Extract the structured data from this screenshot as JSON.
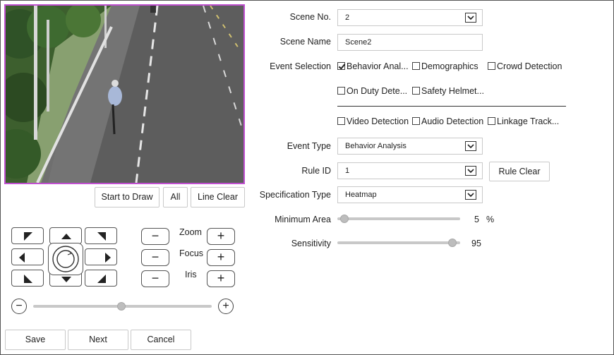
{
  "video": {
    "scene": "street-camera-view"
  },
  "draw": {
    "start_label": "Start to Draw",
    "all_label": "All",
    "clear_label": "Line Clear"
  },
  "ptz": {
    "zoom_label": "Zoom",
    "focus_label": "Focus",
    "iris_label": "Iris",
    "minus": "−",
    "plus": "+",
    "speed_level": 0.5
  },
  "form": {
    "scene_no": {
      "label": "Scene No.",
      "value": "2"
    },
    "scene_name": {
      "label": "Scene Name",
      "value": "Scene2"
    },
    "event_selection": {
      "label": "Event Selection",
      "options": [
        {
          "label": "Behavior Anal...",
          "checked": true
        },
        {
          "label": "Demographics",
          "checked": false
        },
        {
          "label": "Crowd Detection",
          "checked": false
        },
        {
          "label": "On Duty Dete...",
          "checked": false
        },
        {
          "label": "Safety Helmet...",
          "checked": false
        },
        {
          "label": "Video Detection",
          "checked": false
        },
        {
          "label": "Audio Detection",
          "checked": false
        },
        {
          "label": "Linkage Track...",
          "checked": false
        }
      ]
    },
    "event_type": {
      "label": "Event Type",
      "value": "Behavior Analysis"
    },
    "rule_id": {
      "label": "Rule ID",
      "value": "1",
      "clear_label": "Rule Clear"
    },
    "spec_type": {
      "label": "Specification Type",
      "value": "Heatmap"
    },
    "min_area": {
      "label": "Minimum Area",
      "value": "5",
      "unit": "%"
    },
    "sensitivity": {
      "label": "Sensitivity",
      "value": "95"
    }
  },
  "footer": {
    "save_label": "Save",
    "next_label": "Next",
    "cancel_label": "Cancel"
  }
}
